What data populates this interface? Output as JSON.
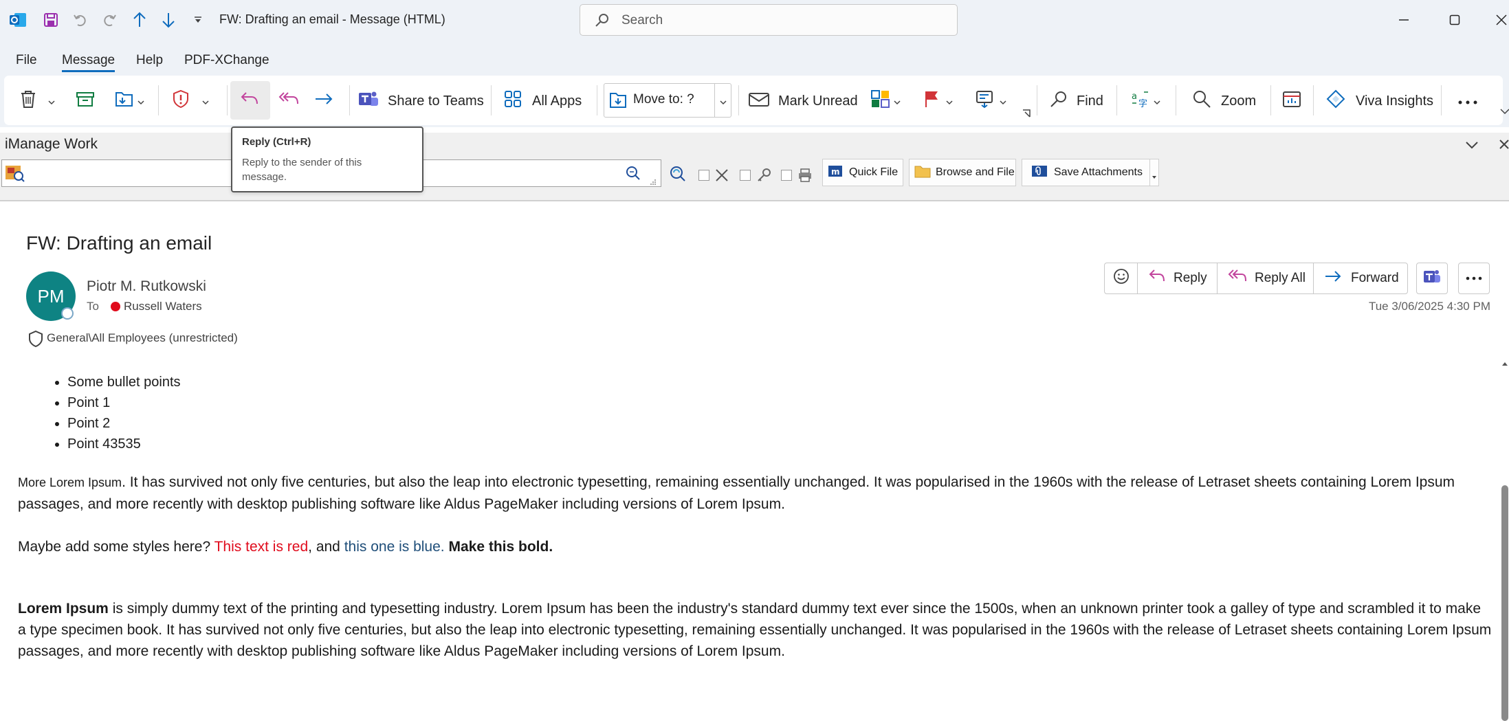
{
  "window": {
    "title": "FW: Drafting an email  -  Message (HTML)",
    "search_placeholder": "Search"
  },
  "menu": {
    "items": [
      "File",
      "Message",
      "Help",
      "PDF-XChange"
    ],
    "active": "Message"
  },
  "ribbon": {
    "share_to_teams": "Share to Teams",
    "all_apps": "All Apps",
    "move_to": "Move to: ?",
    "mark_unread": "Mark Unread",
    "find": "Find",
    "zoom": "Zoom",
    "viva_insights": "Viva Insights"
  },
  "tooltip": {
    "title": "Reply (Ctrl+R)",
    "description": "Reply to the sender of this message."
  },
  "imanage": {
    "title": "iManage Work",
    "quick_file": "Quick File",
    "browse_and_file": "Browse and File",
    "save_attachments": "Save Attachments"
  },
  "message": {
    "subject": "FW: Drafting an email",
    "avatar_initials": "PM",
    "sender": "Piotr M. Rutkowski",
    "to_label": "To",
    "recipient": "Russell Waters",
    "sensitivity": "General\\All Employees (unrestricted)",
    "date": "Tue 3/06/2025 4:30 PM",
    "actions": {
      "reply": "Reply",
      "reply_all": "Reply All",
      "forward": "Forward"
    },
    "bullets": [
      "Some bullet points",
      "Point 1",
      "Point 2",
      "Point 43535"
    ],
    "para1_small": "More Lorem Ipsum",
    "para1_rest": ". It has survived not only five centuries, but also the leap into electronic typesetting, remaining essentially unchanged. It was popularised in the 1960s with the release of Letraset sheets containing Lorem Ipsum passages, and more recently with desktop publishing software like Aldus PageMaker including versions of Lorem Ipsum.",
    "para2_lead": "Maybe add some styles here? ",
    "para2_red": "This text is red",
    "para2_mid": ", and ",
    "para2_blue": "this one is blue.",
    "para2_bold": "Make this bold.",
    "para3_bold": "Lorem Ipsum",
    "para3_rest": " is simply dummy text of the printing and typesetting industry. Lorem Ipsum has been the industry's standard dummy text ever since the 1500s, when an unknown printer took a galley of type and scrambled it to make a type specimen book. It has survived not only five centuries, but also the leap into electronic typesetting, remaining essentially unchanged. It was popularised in the 1960s with the release of Letraset sheets containing Lorem Ipsum passages, and more recently with desktop publishing software like Aldus PageMaker including versions of Lorem Ipsum."
  },
  "colors": {
    "accent": "#0f6cbd",
    "avatar": "#0e8383",
    "red_text": "#e00b1c",
    "blue_text": "#1f4e79",
    "reply_icon": "#c2459d",
    "flag": "#d13438"
  }
}
